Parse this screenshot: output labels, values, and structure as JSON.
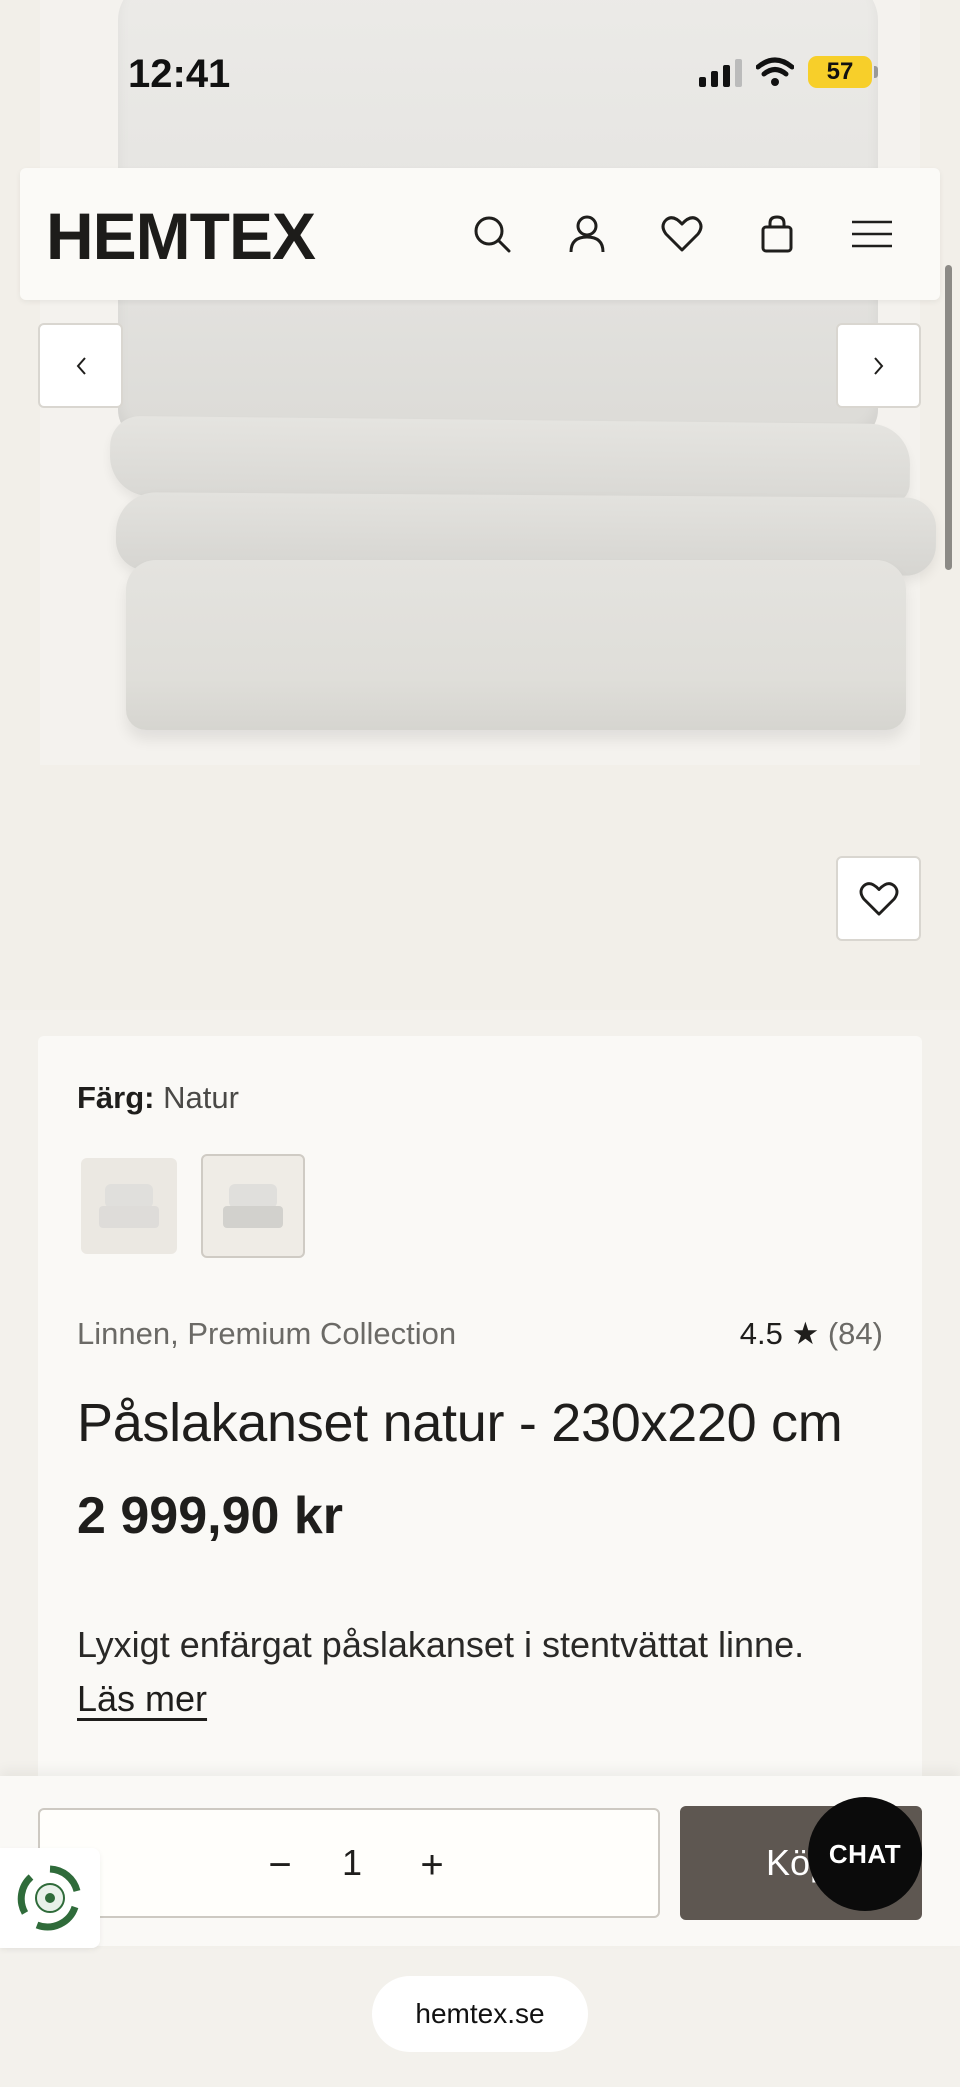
{
  "status_bar": {
    "time": "12:41",
    "battery": "57"
  },
  "header": {
    "logo": "HEMTEX",
    "icons": [
      "search-icon",
      "account-icon",
      "heart-icon",
      "bag-icon",
      "menu-icon"
    ]
  },
  "product": {
    "color_label": "Färg:",
    "color_value": "Natur",
    "collection": "Linnen, Premium Collection",
    "rating_value": "4.5 ★",
    "rating_count": "(84)",
    "title": "Påslakanset natur - 230x220 cm",
    "price": "2 999,90 kr",
    "description": "Lyxigt enfärgat påslakanset i stentvättat linne.",
    "read_more": "Läs mer"
  },
  "buy_bar": {
    "qty_minus": "−",
    "quantity": "1",
    "qty_plus": "+",
    "buy_label": "Köp"
  },
  "chat": {
    "label": "CHAT"
  },
  "browser": {
    "url": "hemtex.se"
  },
  "colors": {
    "buy_button": "#5e5751",
    "background": "#f3f1ec",
    "card": "#faf9f6",
    "battery": "#f7cf2a"
  }
}
